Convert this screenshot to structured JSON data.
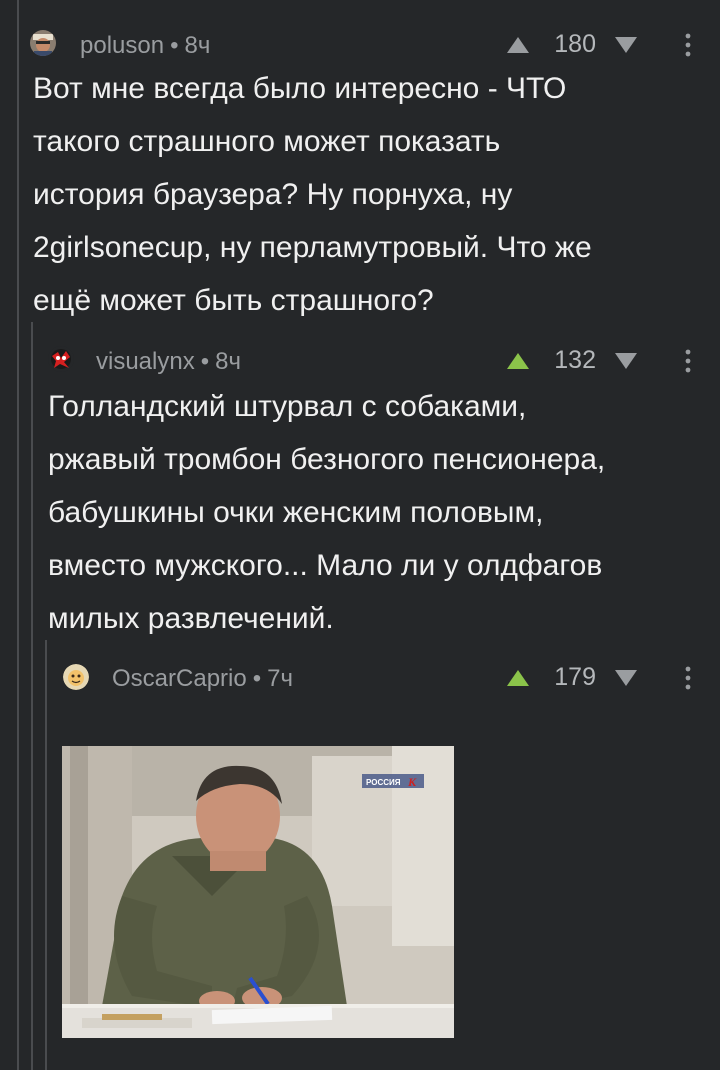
{
  "comments": [
    {
      "author": "poluson",
      "time": "8ч",
      "rating": "180",
      "text": "Вот мне всегда было интересно - ЧТО\nтакого страшного может показать\nистория браузера? Ну порнуха, ну\n2girlsonecup, ну перламутровый. Что же\nещё может быть страшного?"
    },
    {
      "author": "visualynx",
      "time": "8ч",
      "rating": "132",
      "text": "Голландский штурвал с собаками,\nржавый тромбон безногого пенсионера,\nбабушкины очки женским половым,\nвместо мужского... Мало ли у олдфагов\nмилых развлечений."
    },
    {
      "author": "OscarCaprio",
      "time": "7ч",
      "rating": "179",
      "tv_logo": "РОССИЯ К"
    }
  ],
  "colors": {
    "background": "#252729",
    "upvote_active": "#8bc34a",
    "upvote_inactive": "#9a9da0",
    "meta": "#9a9da0",
    "text": "#f0f0f0"
  },
  "icons": [
    "upvote-icon",
    "downvote-icon",
    "more-icon"
  ]
}
